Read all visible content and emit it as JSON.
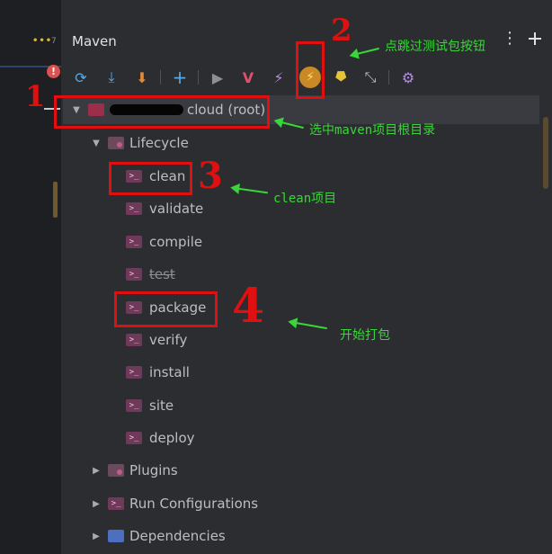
{
  "editor": {
    "more_dots": "•••",
    "tab_count": "7",
    "error_badge": "!"
  },
  "panel": {
    "title": "Maven",
    "menu_icon": "kebab-menu-icon",
    "hide_icon": "minus-icon"
  },
  "toolbar": {
    "reload": "⟳",
    "generate": "⤓",
    "download": "⬇",
    "add": "+",
    "run": "▶",
    "execute_goal": "V",
    "toggle_offline": "⚡",
    "skip_tests": "⚡",
    "show_dependencies": "⯂",
    "collapse": "⤡",
    "settings": "⚙"
  },
  "tree": {
    "root_label": "cloud (root)",
    "lifecycle": "Lifecycle",
    "goals": [
      "clean",
      "validate",
      "compile",
      "test",
      "package",
      "verify",
      "install",
      "site",
      "deploy"
    ],
    "plugins": "Plugins",
    "run_configurations": "Run Configurations",
    "dependencies": "Dependencies"
  },
  "annotations": {
    "num1": "1",
    "num2": "2",
    "num3": "3",
    "num4": "4",
    "text_skip": "点跳过测试包按钮",
    "text_root": "选中maven项目根目录",
    "text_clean": "clean项目",
    "text_package": "开始打包"
  },
  "colors": {
    "accent_red": "#e01010",
    "accent_green": "#39d639",
    "panel_bg": "#2b2d30",
    "selected_row": "#393b40"
  }
}
